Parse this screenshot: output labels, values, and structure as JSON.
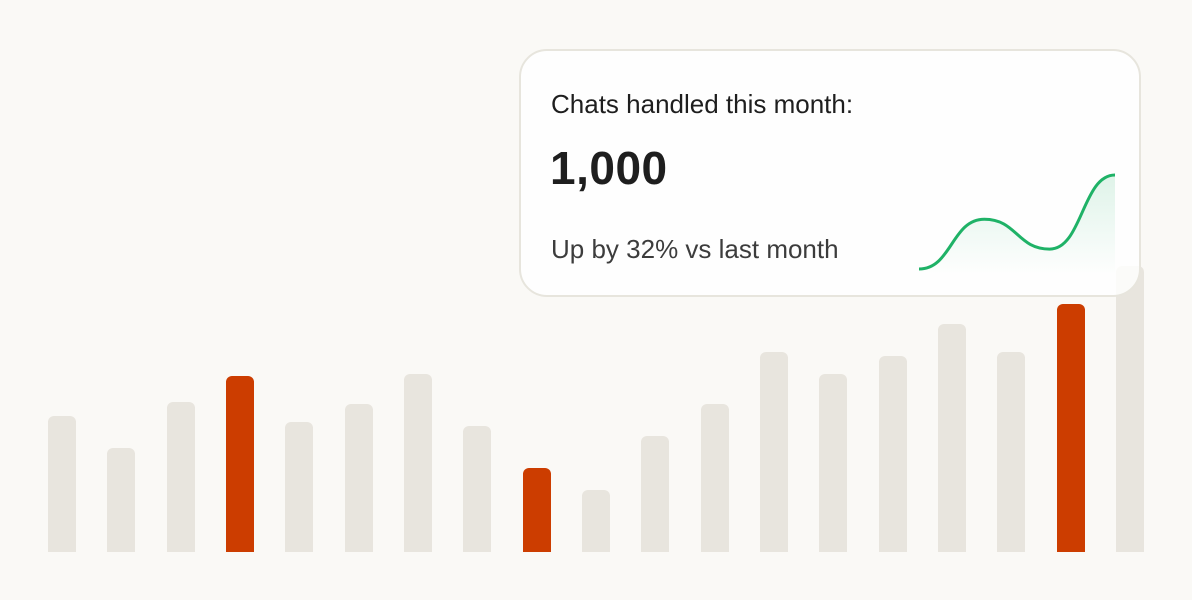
{
  "card": {
    "title": "Chats handled this month:",
    "value": "1,000",
    "trend_text": "Up by 32% vs last month",
    "sparkline_values": [
      10,
      55,
      28,
      95
    ],
    "sparkline_color": "#1fb267"
  },
  "colors": {
    "background": "#faf9f6",
    "bar_default": "#e8e5de",
    "bar_highlight": "#cc3d00",
    "card_border": "#e7e5dd"
  },
  "chart_data": {
    "type": "bar",
    "ylim": [
      0,
      300
    ],
    "values": [
      136,
      104,
      150,
      176,
      130,
      148,
      178,
      126,
      84,
      62,
      116,
      148,
      200,
      178,
      196,
      228,
      200,
      248,
      286
    ],
    "highlighted": [
      3,
      8,
      17
    ],
    "grid": false,
    "axes": false,
    "legend": "none"
  }
}
